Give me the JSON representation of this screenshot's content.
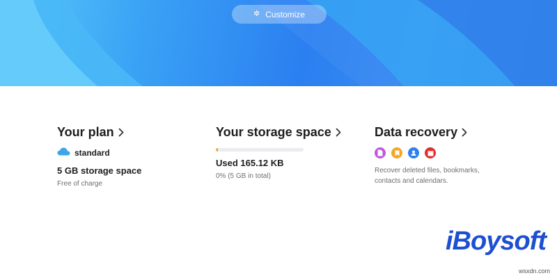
{
  "hero": {
    "customize_label": "Customize",
    "customize_icon": "sparkle-icon"
  },
  "plan": {
    "title": "Your plan",
    "plan_name": "standard",
    "storage": "5 GB storage space",
    "price": "Free of charge",
    "icon": "cloud-icon",
    "icon_color": "#3ea5e8"
  },
  "storage": {
    "title": "Your storage space",
    "used": "Used 165.12 KB",
    "percent_text": "0% (5 GB in total)",
    "fill_fraction": 0.012,
    "fill_color": "#f5a623"
  },
  "recovery": {
    "title": "Data recovery",
    "apps": [
      {
        "name": "files-icon",
        "color": "#c156dc"
      },
      {
        "name": "bookmarks-icon",
        "color": "#f5a623"
      },
      {
        "name": "contacts-icon",
        "color": "#2f7ff0"
      },
      {
        "name": "calendars-icon",
        "color": "#e22c2c"
      }
    ],
    "description": "Recover deleted files, bookmarks, contacts and calendars."
  },
  "watermark": {
    "brand": "iBoysoft",
    "site": "wsxdn.com"
  }
}
